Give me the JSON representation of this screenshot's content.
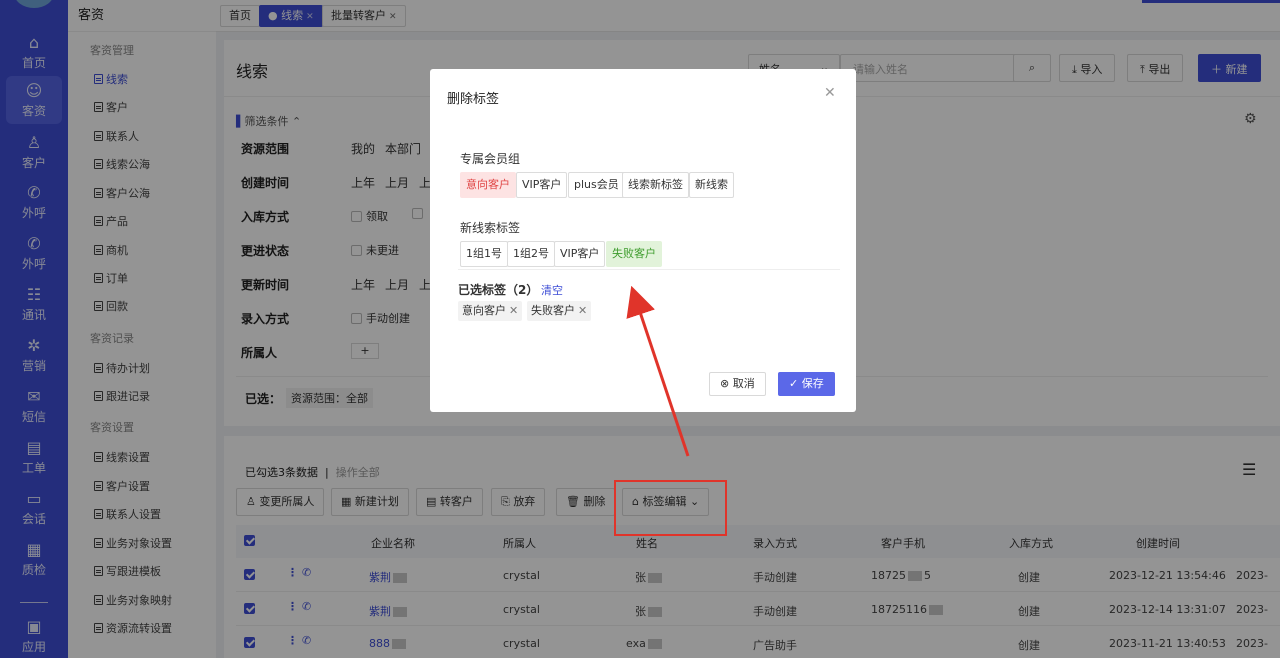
{
  "rail": {
    "items": [
      {
        "label": "首页",
        "icon": "⌂"
      },
      {
        "label": "客资",
        "icon": "☺"
      },
      {
        "label": "客户",
        "icon": "♙"
      },
      {
        "label": "外呼",
        "icon": "✆"
      },
      {
        "label": "外呼",
        "icon": "✆"
      },
      {
        "label": "通讯",
        "icon": "☷"
      },
      {
        "label": "营销",
        "icon": "✲"
      },
      {
        "label": "短信",
        "icon": "✉"
      },
      {
        "label": "工单",
        "icon": "▤"
      },
      {
        "label": "会话",
        "icon": "▭"
      },
      {
        "label": "质检",
        "icon": "▦"
      },
      {
        "label": "应用",
        "icon": "▣"
      }
    ]
  },
  "menu": {
    "title": "客资",
    "group1": "客资管理",
    "items1": [
      "线索",
      "客户",
      "联系人",
      "线索公海",
      "客户公海",
      "产品",
      "商机",
      "订单",
      "回款"
    ],
    "group2": "客资记录",
    "items2": [
      "待办计划",
      "跟进记录"
    ],
    "group3": "客资设置",
    "items3": [
      "线索设置",
      "客户设置",
      "联系人设置",
      "业务对象设置",
      "写跟进模板",
      "业务对象映射",
      "资源流转设置"
    ]
  },
  "tabs": [
    {
      "label": "首页"
    },
    {
      "label": "线索"
    },
    {
      "label": "批量转客户"
    }
  ],
  "header": {
    "title": "线索",
    "select_value": "姓名",
    "search_placeholder": "请输入姓名",
    "import_label": "导入",
    "export_label": "导出",
    "new_label": "新建"
  },
  "filter": {
    "toggle_label": "筛选条件",
    "rows": [
      {
        "label": "资源范围",
        "opts": [
          "我的",
          "本部门"
        ]
      },
      {
        "label": "创建时间",
        "opts": [
          "上年",
          "上月",
          "上"
        ]
      },
      {
        "label": "入库方式",
        "opts": [
          "领取"
        ]
      },
      {
        "label": "更进状态",
        "opts": [
          "未更进"
        ]
      },
      {
        "label": "更新时间",
        "opts": [
          "上年",
          "上月",
          "上"
        ]
      },
      {
        "label": "录入方式",
        "opts": [
          "手动创建"
        ]
      },
      {
        "label": "所属人",
        "opts": [
          "+"
        ]
      }
    ],
    "selected_label": "已选：",
    "selected_chip": "资源范围：全部"
  },
  "list": {
    "selected_info": "已勾选3条数据",
    "operate_all": "操作全部",
    "toolbar": [
      "变更所属人",
      "新建计划",
      "转客户",
      "放弃",
      "删除",
      "标签编辑"
    ],
    "columns": [
      "企业名称",
      "所属人",
      "姓名",
      "录入方式",
      "客户手机",
      "入库方式",
      "创建时间",
      "2023-"
    ],
    "rows": [
      {
        "company": "紫荆",
        "owner": "crystal",
        "name": "张",
        "entry": "手动创建",
        "phone_a": "18725",
        "phone_b": "5",
        "storage": "创建",
        "created": "2023-12-21 13:54:46",
        "more": "2023-"
      },
      {
        "company": "紫荆",
        "owner": "crystal",
        "name": "张",
        "entry": "手动创建",
        "phone_a": "18725116",
        "phone_b": "",
        "storage": "创建",
        "created": "2023-12-14 13:31:07",
        "more": "2023-"
      },
      {
        "company": "888",
        "owner": "crystal",
        "name": "exa",
        "entry": "广告助手",
        "phone_a": "",
        "phone_b": "",
        "storage": "创建",
        "created": "2023-11-21 13:40:53",
        "more": "2023-"
      }
    ]
  },
  "modal": {
    "title": "删除标签",
    "group1_title": "专属会员组",
    "group1_tags": [
      "意向客户",
      "VIP客户",
      "plus会员",
      "线索新标签",
      "新线索"
    ],
    "group2_title": "新线索标签",
    "group2_tags": [
      "1组1号",
      "1组2号",
      "VIP客户",
      "失败客户"
    ],
    "selected_title": "已选标签（2）",
    "clear_label": "清空",
    "selected_tags": [
      "意向客户",
      "失败客户"
    ],
    "cancel_label": "取消",
    "save_label": "保存"
  },
  "colors": {
    "brand": "#3f4fd6",
    "red_tag_bg": "#fde3e3",
    "green_tag_bg": "#e2f3da",
    "annotation": "#e0342a"
  }
}
